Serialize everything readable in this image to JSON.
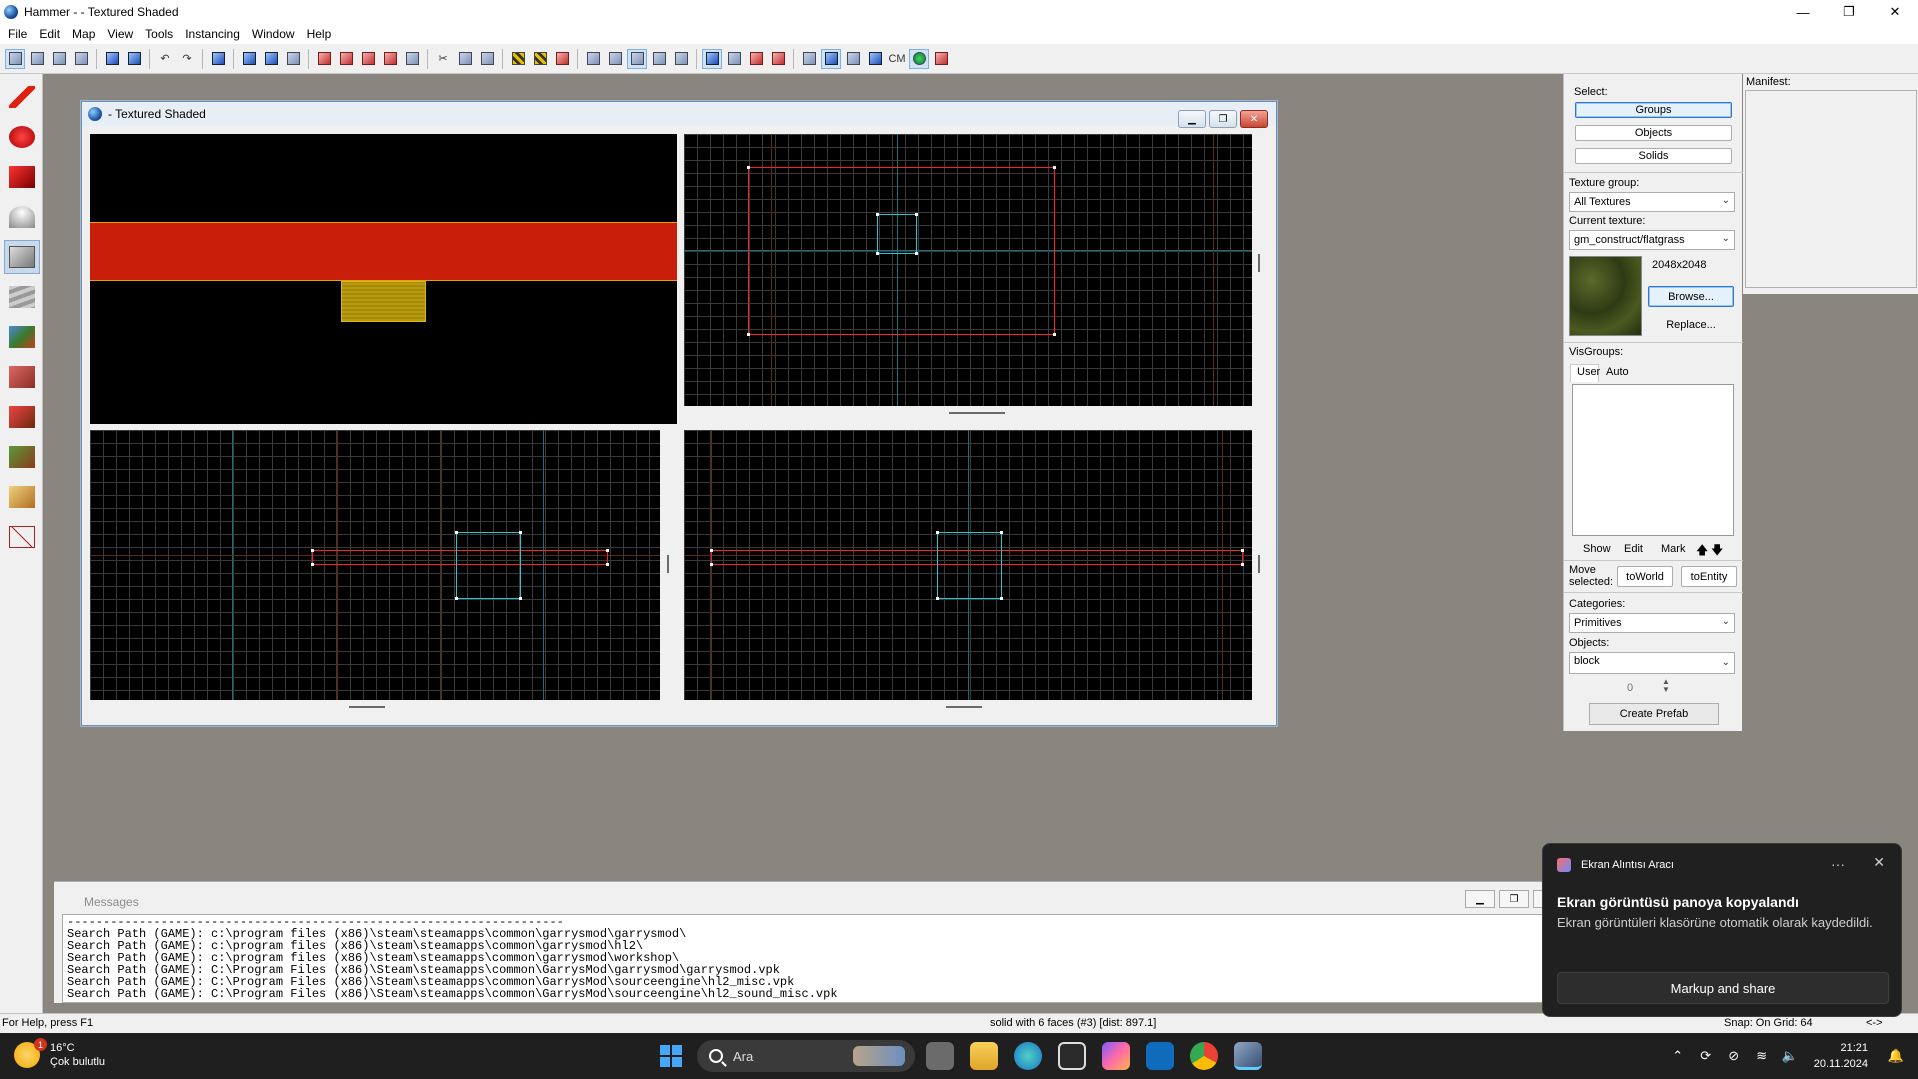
{
  "window": {
    "title": "Hammer -  - Textured Shaded",
    "minimize": "—",
    "maximize": "❐",
    "close": "✕"
  },
  "menu": [
    "File",
    "Edit",
    "Map",
    "View",
    "Tools",
    "Instancing",
    "Window",
    "Help"
  ],
  "toolbar": {
    "cm_label": "CM"
  },
  "mdi": {
    "title": "- Textured Shaded"
  },
  "right_panel": {
    "select_label": "Select:",
    "groups": "Groups",
    "objects": "Objects",
    "solids": "Solids",
    "texture_group_label": "Texture group:",
    "texture_group_value": "All Textures",
    "current_texture_label": "Current texture:",
    "current_texture_value": "gm_construct/flatgrass",
    "texture_size": "2048x2048",
    "browse": "Browse...",
    "replace": "Replace...",
    "visgroups_label": "VisGroups:",
    "tab_user": "User",
    "tab_auto": "Auto",
    "show": "Show",
    "edit": "Edit",
    "mark": "Mark",
    "up_arrow": "🡅",
    "down_arrow": "🡇",
    "move_selected_label": "Move selected:",
    "to_world": "toWorld",
    "to_entity": "toEntity",
    "categories_label": "Categories:",
    "categories_value": "Primitives",
    "objects_label": "Objects:",
    "objects_value": "block",
    "spinner_value": "0",
    "create_prefab": "Create Prefab"
  },
  "manifest": {
    "label": "Manifest:"
  },
  "messages": {
    "title": "Messages",
    "lines": [
      "---------------------------------------------------------------------",
      "Search Path (GAME): c:\\program files (x86)\\steam\\steamapps\\common\\garrysmod\\garrysmod\\",
      "Search Path (GAME): c:\\program files (x86)\\steam\\steamapps\\common\\garrysmod\\hl2\\",
      "Search Path (GAME): c:\\program files (x86)\\steam\\steamapps\\common\\garrysmod\\workshop\\",
      "Search Path (GAME): C:\\Program Files (x86)\\Steam\\steamapps\\common\\GarrysMod\\garrysmod\\garrysmod.vpk",
      "Search Path (GAME): C:\\Program Files (x86)\\Steam\\steamapps\\common\\GarrysMod\\sourceengine\\hl2_misc.vpk",
      "Search Path (GAME): C:\\Program Files (x86)\\Steam\\steamapps\\common\\GarrysMod\\sourceengine\\hl2_sound_misc.vpk"
    ]
  },
  "status": {
    "help": "For Help, press F1",
    "selection": "solid with 6 faces (#3)  [dist: 897.1]",
    "snap": "Snap: On Grid: 64",
    "arrows": "<->"
  },
  "taskbar": {
    "temperature": "16°C",
    "weather": "Çok bulutlu",
    "weather_badge": "1",
    "search_placeholder": "Ara",
    "time": "21:21",
    "date": "20.11.2024"
  },
  "toast": {
    "app": "Ekran Alıntısı Aracı",
    "more": "···",
    "close": "✕",
    "heading": "Ekran görüntüsü panoya kopyalandı",
    "body": "Ekran görüntüleri klasörüne otomatik olarak kaydedildi.",
    "action": "Markup and share"
  },
  "colors": {
    "selection_red": "#ff2020",
    "brush_cyan": "#25c6d6",
    "texture_red": "#c81e0a",
    "texture_yellow": "#b89a10"
  }
}
